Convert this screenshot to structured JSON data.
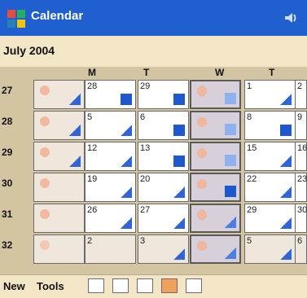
{
  "app": {
    "title": "Calendar"
  },
  "header": {
    "month": "July 2004"
  },
  "days": [
    "",
    "M",
    "T",
    "W",
    "T"
  ],
  "weeks": [
    {
      "num": "27",
      "dates": [
        "",
        "28",
        "29",
        "",
        "1",
        "2"
      ]
    },
    {
      "num": "28",
      "dates": [
        "",
        "5",
        "6",
        "",
        "8",
        "9"
      ]
    },
    {
      "num": "29",
      "dates": [
        "",
        "12",
        "13",
        "",
        "15",
        "16"
      ]
    },
    {
      "num": "30",
      "dates": [
        "",
        "19",
        "20",
        "",
        "22",
        "23"
      ]
    },
    {
      "num": "31",
      "dates": [
        "",
        "26",
        "27",
        "",
        "29",
        "30"
      ]
    },
    {
      "num": "32",
      "dates": [
        "",
        "2",
        "3",
        "",
        "5",
        "6"
      ]
    }
  ],
  "toolbar": {
    "new_label": "New",
    "tools_label": "Tools"
  }
}
